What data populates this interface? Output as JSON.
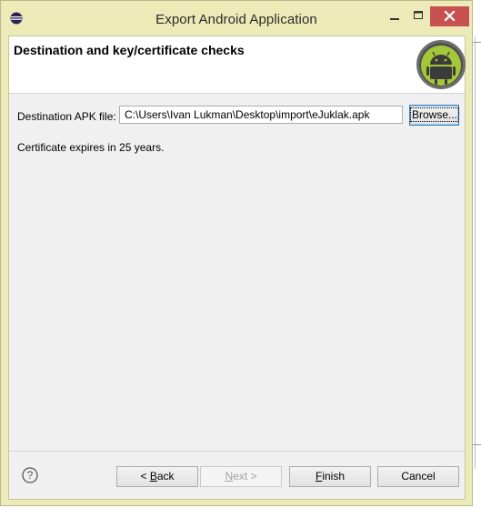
{
  "window": {
    "title": "Export Android Application",
    "accent_color": "#eceab7",
    "close_color": "#c75050"
  },
  "header": {
    "title": "Destination and key/certificate checks",
    "logo_icon": "android-logo-icon"
  },
  "form": {
    "destination_label": "Destination APK file:",
    "destination_value": "C:\\Users\\Ivan Lukman\\Desktop\\import\\eJuklak.apk",
    "browse_label": "Browse...",
    "certificate_status": "Certificate expires in 25 years."
  },
  "buttons": {
    "back_key": "B",
    "back_rest": "ack",
    "back_prefix": "< ",
    "next_key": "N",
    "next_rest": "ext >",
    "finish_key": "F",
    "finish_rest": "inish",
    "cancel": "Cancel"
  },
  "icons": {
    "help": "help-icon",
    "app": "eclipse-icon",
    "minimize": "minimize-icon",
    "maximize": "maximize-icon",
    "close": "close-icon"
  }
}
